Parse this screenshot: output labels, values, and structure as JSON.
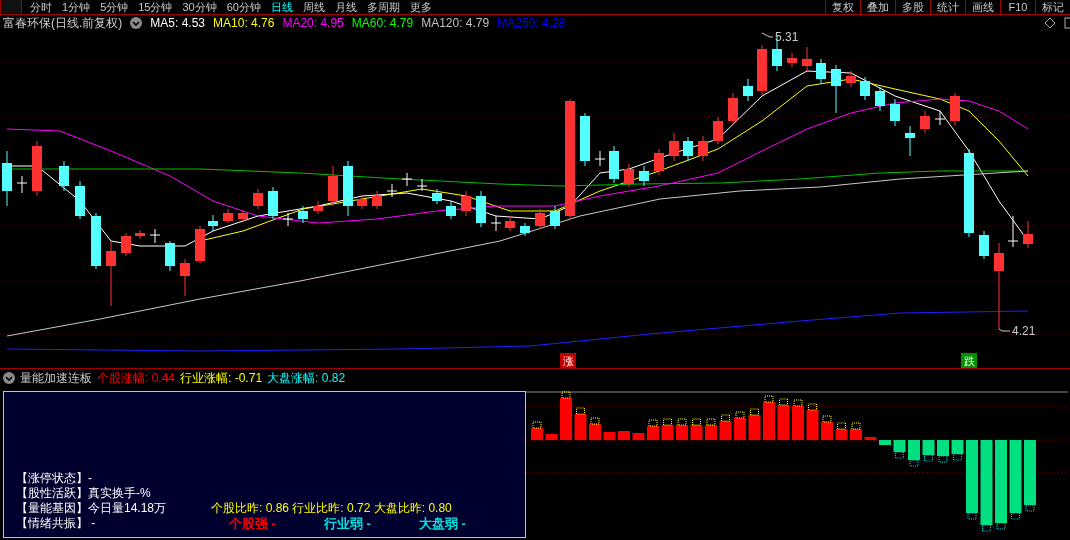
{
  "toolbar": {
    "left_tabs": [
      {
        "label": "分时",
        "selected": false
      },
      {
        "label": "1分钟",
        "selected": false
      },
      {
        "label": "5分钟",
        "selected": false
      },
      {
        "label": "15分钟",
        "selected": false
      },
      {
        "label": "30分钟",
        "selected": false
      },
      {
        "label": "60分钟",
        "selected": false
      },
      {
        "label": "日线",
        "selected": true
      },
      {
        "label": "周线",
        "selected": false
      },
      {
        "label": "月线",
        "selected": false
      },
      {
        "label": "多周期",
        "selected": false
      },
      {
        "label": "更多",
        "selected": false
      }
    ],
    "right_buttons": [
      "复权",
      "叠加",
      "多股",
      "统计",
      "画线",
      "F10",
      "标记"
    ]
  },
  "price_panel": {
    "title": "富春环保(日线.前复权)",
    "ma_labels": [
      {
        "label": "MA5: 4.53",
        "color": "#ffffff"
      },
      {
        "label": "MA10: 4.76",
        "color": "#ffff00"
      },
      {
        "label": "MA20: 4.95",
        "color": "#ff00ff"
      },
      {
        "label": "MA60: 4.79",
        "color": "#00ff00"
      },
      {
        "label": "MA120: 4.79",
        "color": "#c0c0c0"
      },
      {
        "label": "MA250: 4.28",
        "color": "#0000ff"
      }
    ],
    "high_label": "5.31",
    "low_label": "4.21",
    "signals": [
      {
        "label": "涨",
        "color": "#c00000"
      },
      {
        "label": "跌",
        "color": "#009000"
      }
    ]
  },
  "indicator_panel": {
    "title": "量能加速连板",
    "stats": [
      {
        "label": "个股涨幅: 0.44",
        "color": "#ff0000"
      },
      {
        "label": "行业涨幅: -0.71",
        "color": "#ffff00"
      },
      {
        "label": "大盘涨幅: 0.82",
        "color": "#00ffff"
      }
    ],
    "info_lines": [
      "【涨停状态】-",
      "【股性活跃】真实换手-%",
      "【量能基因】今日量14.18万",
      "【情绪共振】 -"
    ],
    "ratios": "个股比昨: 0.86 行业比昨: 0.72 大盘比昨: 0.80",
    "strength": [
      {
        "label": "个股强 -",
        "color": "#ff0000"
      },
      {
        "label": "行业弱 -",
        "color": "#00e0e0"
      },
      {
        "label": "大盘弱 -",
        "color": "#00e0e0"
      }
    ]
  }
}
